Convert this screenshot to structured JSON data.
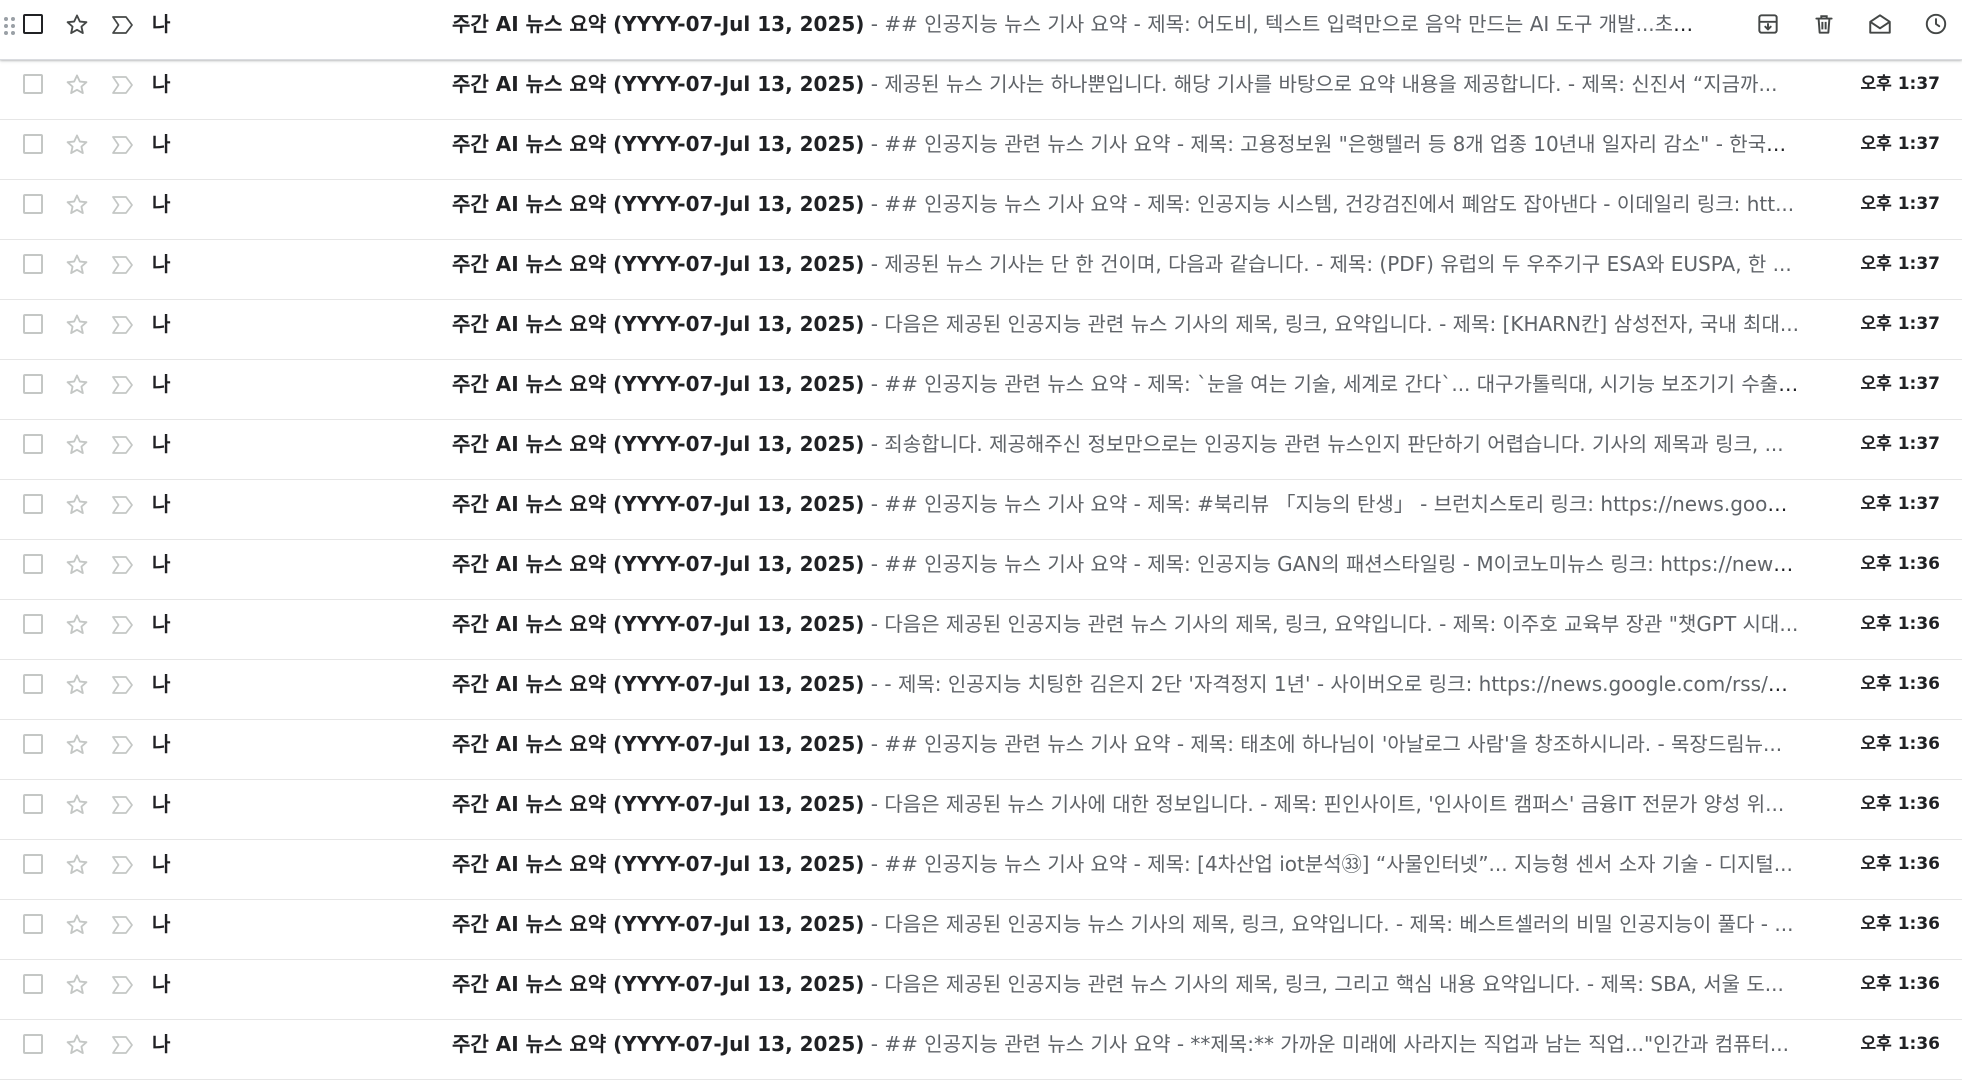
{
  "colors": {
    "icon": "#444746",
    "icon_light": "#c4c7c5",
    "text_primary": "#202124",
    "text_secondary": "#5f6368",
    "divider": "#e6e6e6"
  },
  "hover_actions": {
    "archive": "archive-icon",
    "delete": "trash-icon",
    "mark_read": "envelope-open-icon",
    "snooze": "clock-icon"
  },
  "emails": [
    {
      "sender": "나",
      "subject": "주간 AI 뉴스 요약 (YYYY-07-Jul 13, 2025)",
      "separator": " - ",
      "snippet": "## 인공지능 뉴스 기사 요약 - 제목: 어도비, 텍스트 입력만으로 음악 만드는 AI 도구 개발...초보...",
      "time": "",
      "hovered": true
    },
    {
      "sender": "나",
      "subject": "주간 AI 뉴스 요약 (YYYY-07-Jul 13, 2025)",
      "separator": " - ",
      "snippet": "제공된 뉴스 기사는 하나뿐입니다. 해당 기사를 바탕으로 요약 내용을 제공합니다. - 제목: 신진서 “지금까...",
      "time": "오후 1:37"
    },
    {
      "sender": "나",
      "subject": "주간 AI 뉴스 요약 (YYYY-07-Jul 13, 2025)",
      "separator": " - ",
      "snippet": "## 인공지능 관련 뉴스 기사 요약 - 제목: 고용정보원 \"은행텔러 등 8개 업종 10년내 일자리 감소\" - 한국일...",
      "time": "오후 1:37"
    },
    {
      "sender": "나",
      "subject": "주간 AI 뉴스 요약 (YYYY-07-Jul 13, 2025)",
      "separator": " - ",
      "snippet": "## 인공지능 뉴스 기사 요약 - 제목: 인공지능 시스템, 건강검진에서 폐암도 잡아낸다 - 이데일리 링크: htt...",
      "time": "오후 1:37"
    },
    {
      "sender": "나",
      "subject": "주간 AI 뉴스 요약 (YYYY-07-Jul 13, 2025)",
      "separator": " - ",
      "snippet": "제공된 뉴스 기사는 단 한 건이며, 다음과 같습니다. - 제목: (PDF) 유럽의 두 우주기구 ESA와 EUSPA, 한 ...",
      "time": "오후 1:37"
    },
    {
      "sender": "나",
      "subject": "주간 AI 뉴스 요약 (YYYY-07-Jul 13, 2025)",
      "separator": " - ",
      "snippet": "다음은 제공된 인공지능 관련 뉴스 기사의 제목, 링크, 요약입니다. - 제목: [KHARN칸] 삼성전자, 국내 최대...",
      "time": "오후 1:37"
    },
    {
      "sender": "나",
      "subject": "주간 AI 뉴스 요약 (YYYY-07-Jul 13, 2025)",
      "separator": " - ",
      "snippet": "## 인공지능 관련 뉴스 요약 - 제목: `눈을 여는 기술, 세계로 간다`... 대구가톨릭대, 시기능 보조기기 수출 ...",
      "time": "오후 1:37"
    },
    {
      "sender": "나",
      "subject": "주간 AI 뉴스 요약 (YYYY-07-Jul 13, 2025)",
      "separator": " - ",
      "snippet": "죄송합니다. 제공해주신 정보만으로는 인공지능 관련 뉴스인지 판단하기 어렵습니다. 기사의 제목과 링크, ...",
      "time": "오후 1:37"
    },
    {
      "sender": "나",
      "subject": "주간 AI 뉴스 요약 (YYYY-07-Jul 13, 2025)",
      "separator": " - ",
      "snippet": "## 인공지능 뉴스 기사 요약 - 제목: #북리뷰 「지능의 탄생」 - 브런치스토리 링크: https://news.google...",
      "time": "오후 1:37"
    },
    {
      "sender": "나",
      "subject": "주간 AI 뉴스 요약 (YYYY-07-Jul 13, 2025)",
      "separator": " - ",
      "snippet": "## 인공지능 뉴스 기사 요약 - 제목: 인공지능 GAN의 패션스타일링 - M이코노미뉴스 링크: https://news....",
      "time": "오후 1:36"
    },
    {
      "sender": "나",
      "subject": "주간 AI 뉴스 요약 (YYYY-07-Jul 13, 2025)",
      "separator": " - ",
      "snippet": "다음은 제공된 인공지능 관련 뉴스 기사의 제목, 링크, 요약입니다. - 제목: 이주호 교육부 장관 \"챗GPT 시대...",
      "time": "오후 1:36"
    },
    {
      "sender": "나",
      "subject": "주간 AI 뉴스 요약 (YYYY-07-Jul 13, 2025)",
      "separator": " - ",
      "snippet": "- 제목: 인공지능 치팅한 김은지 2단 '자격정지 1년' - 사이버오로 링크: https://news.google.com/rss/arti...",
      "time": "오후 1:36"
    },
    {
      "sender": "나",
      "subject": "주간 AI 뉴스 요약 (YYYY-07-Jul 13, 2025)",
      "separator": " - ",
      "snippet": "## 인공지능 관련 뉴스 기사 요약 - 제목: 태초에 하나님이 '아날로그 사람'을 창조하시니라. - 목장드림뉴...",
      "time": "오후 1:36"
    },
    {
      "sender": "나",
      "subject": "주간 AI 뉴스 요약 (YYYY-07-Jul 13, 2025)",
      "separator": " - ",
      "snippet": "다음은 제공된 뉴스 기사에 대한 정보입니다. - 제목: 핀인사이트, '인사이트 캠퍼스' 금융IT 전문가 양성 위...",
      "time": "오후 1:36"
    },
    {
      "sender": "나",
      "subject": "주간 AI 뉴스 요약 (YYYY-07-Jul 13, 2025)",
      "separator": " - ",
      "snippet": "## 인공지능 뉴스 기사 요약 - 제목: [4차산업 iot분석㉝] “사물인터넷”... 지능형 센서 소자 기술 - 디지털...",
      "time": "오후 1:36"
    },
    {
      "sender": "나",
      "subject": "주간 AI 뉴스 요약 (YYYY-07-Jul 13, 2025)",
      "separator": " - ",
      "snippet": "다음은 제공된 인공지능 뉴스 기사의 제목, 링크, 요약입니다. - 제목: 베스트셀러의 비밀 인공지능이 풀다 - ...",
      "time": "오후 1:36"
    },
    {
      "sender": "나",
      "subject": "주간 AI 뉴스 요약 (YYYY-07-Jul 13, 2025)",
      "separator": " - ",
      "snippet": "다음은 제공된 인공지능 관련 뉴스 기사의 제목, 링크, 그리고 핵심 내용 요약입니다. - 제목: SBA, 서울 도...",
      "time": "오후 1:36"
    },
    {
      "sender": "나",
      "subject": "주간 AI 뉴스 요약 (YYYY-07-Jul 13, 2025)",
      "separator": " - ",
      "snippet": "## 인공지능 관련 뉴스 기사 요약 - **제목:** 가까운 미래에 사라지는 직업과 남는 직업...\"인간과 컴퓨터...",
      "time": "오후 1:36"
    }
  ]
}
